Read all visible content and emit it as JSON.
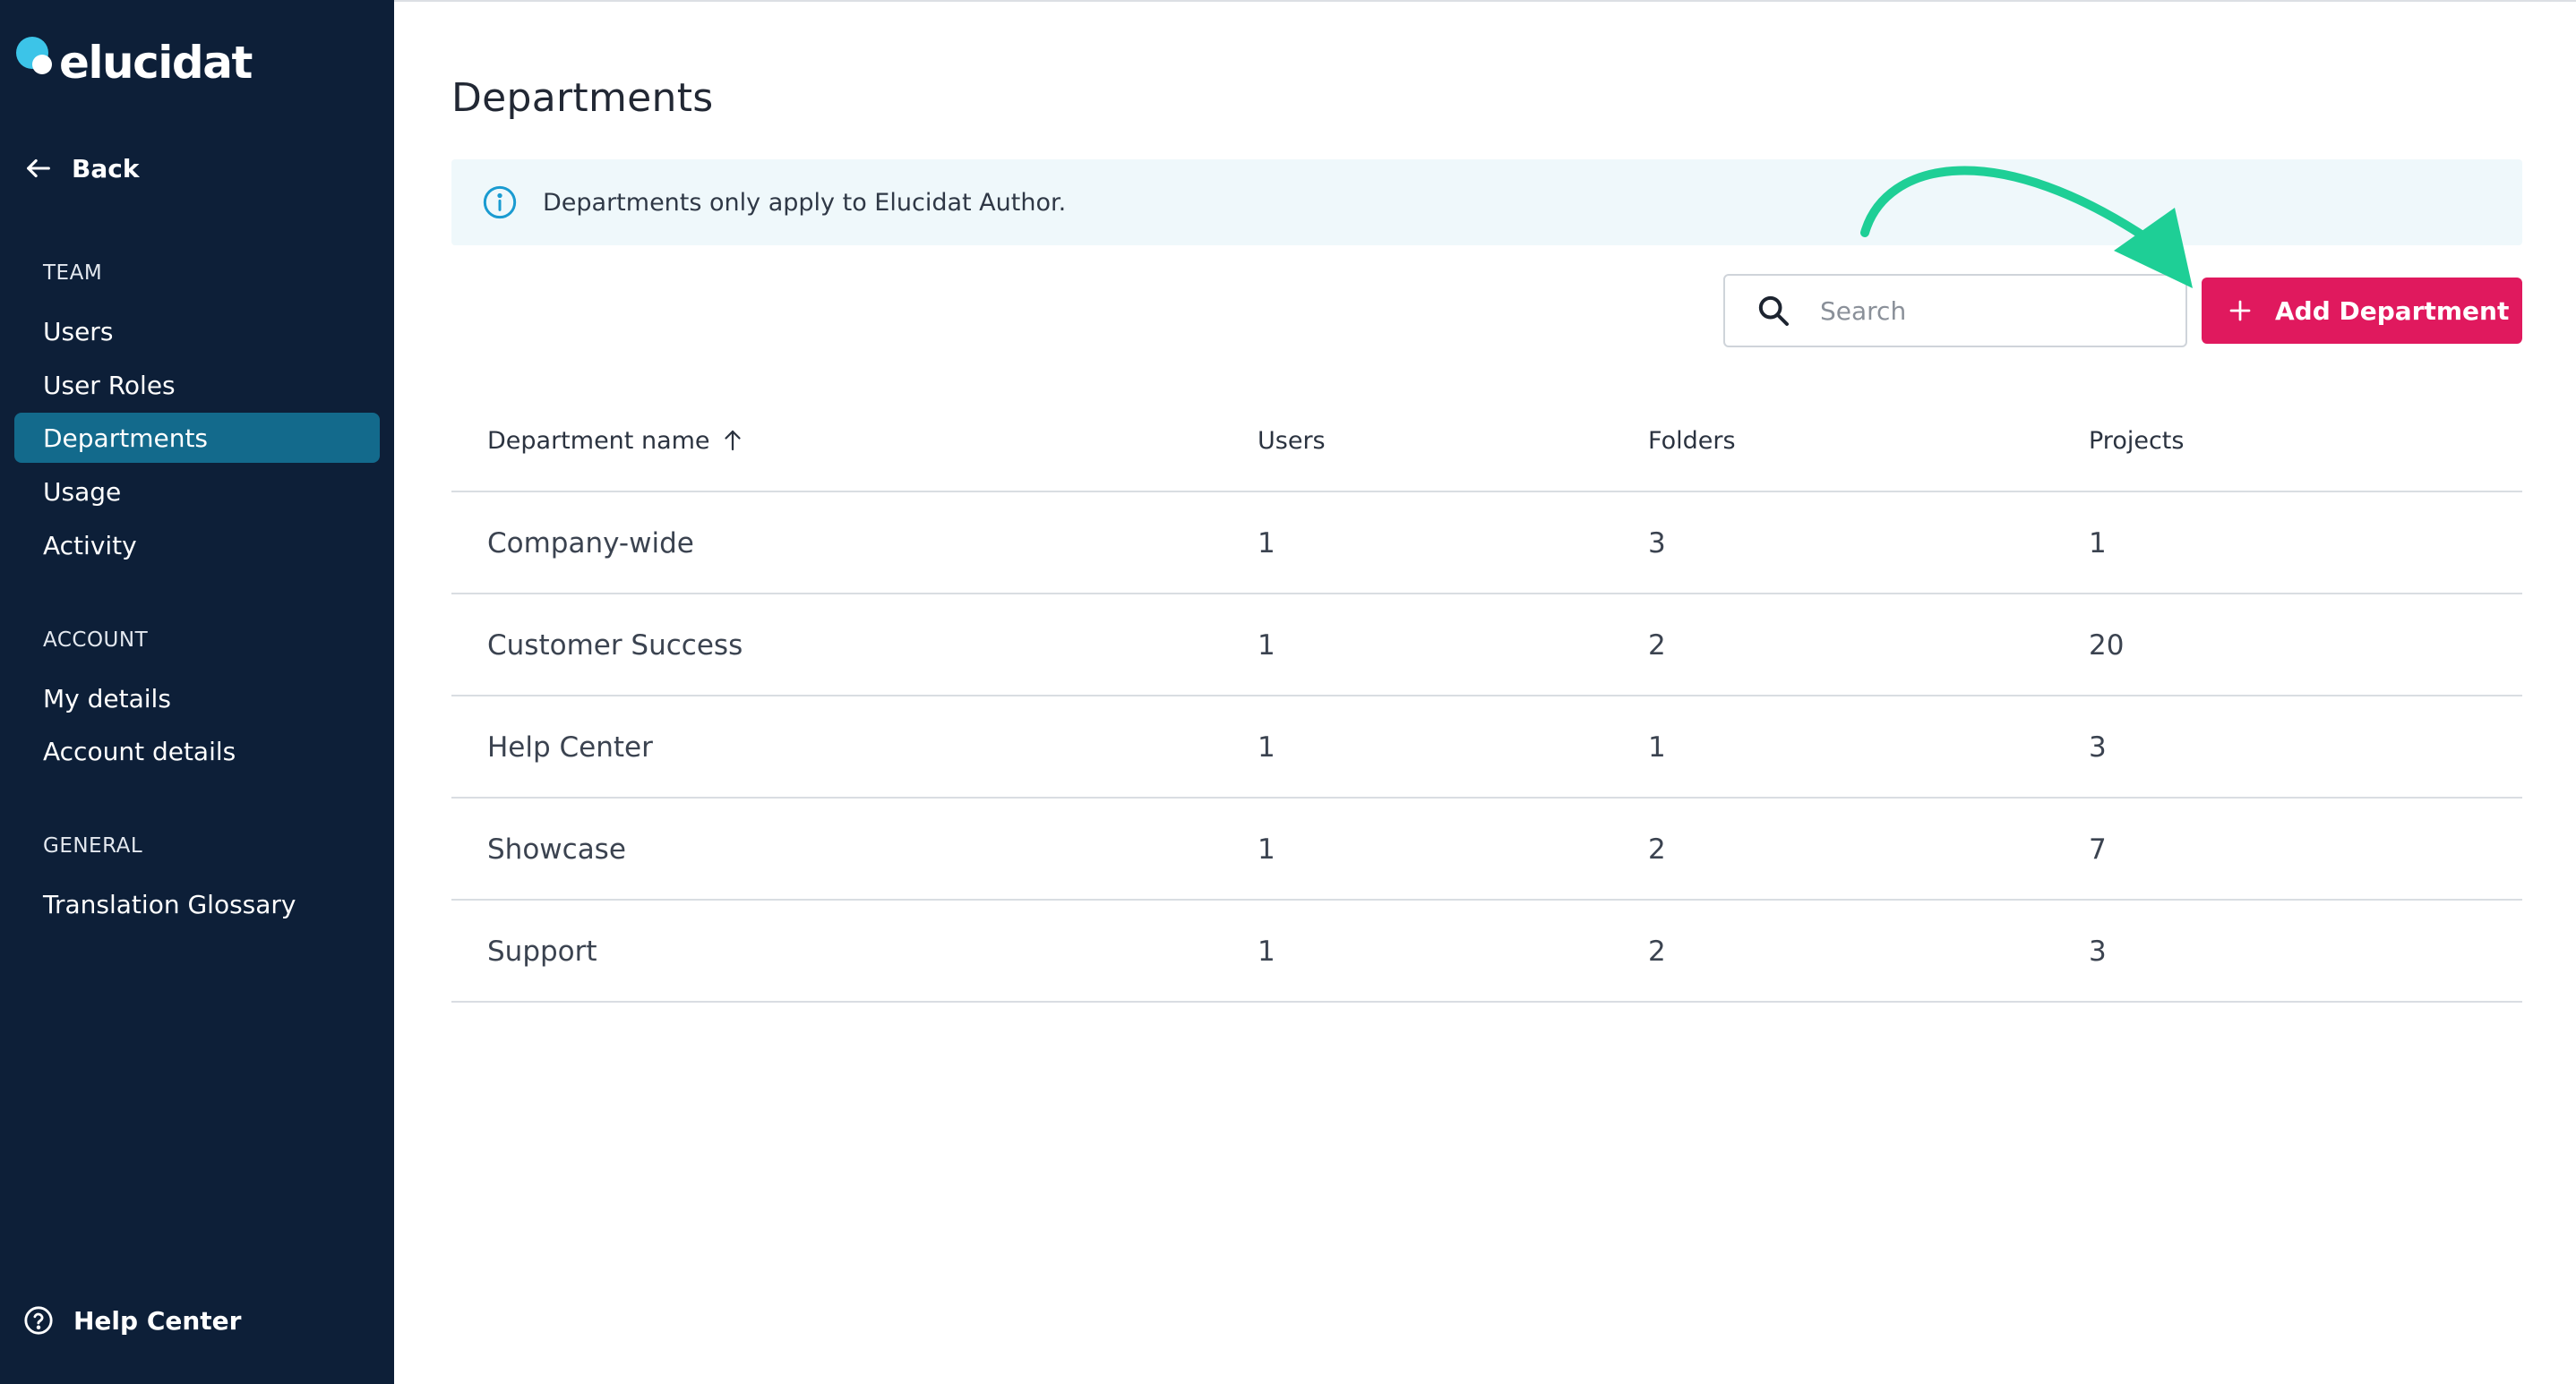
{
  "brand": {
    "name": "elucidat"
  },
  "sidebar": {
    "back_label": "Back",
    "sections": [
      {
        "label": "TEAM",
        "items": [
          {
            "label": "Users"
          },
          {
            "label": "User Roles"
          },
          {
            "label": "Departments",
            "active": true
          },
          {
            "label": "Usage"
          },
          {
            "label": "Activity"
          }
        ]
      },
      {
        "label": "ACCOUNT",
        "items": [
          {
            "label": "My details"
          },
          {
            "label": "Account details"
          }
        ]
      },
      {
        "label": "GENERAL",
        "items": [
          {
            "label": "Translation Glossary"
          }
        ]
      }
    ],
    "help_label": "Help Center"
  },
  "main": {
    "title": "Departments",
    "info_text": "Departments only apply to Elucidat Author.",
    "search": {
      "placeholder": "Search",
      "value": ""
    },
    "add_button_label": "Add Department",
    "table": {
      "columns": [
        "Department name",
        "Users",
        "Folders",
        "Projects"
      ],
      "sort": {
        "column": "Department name",
        "direction": "ascending"
      },
      "rows": [
        {
          "name": "Company-wide",
          "users": "1",
          "folders": "3",
          "projects": "1"
        },
        {
          "name": "Customer Success",
          "users": "1",
          "folders": "2",
          "projects": "20"
        },
        {
          "name": "Help Center",
          "users": "1",
          "folders": "1",
          "projects": "3"
        },
        {
          "name": "Showcase",
          "users": "1",
          "folders": "2",
          "projects": "7"
        },
        {
          "name": "Support",
          "users": "1",
          "folders": "2",
          "projects": "3"
        }
      ]
    }
  },
  "colors": {
    "sidebar_bg": "#0d1f38",
    "active_item": "#136a8c",
    "primary_button": "#e0195e",
    "info_banner_bg": "#eff8fb",
    "annotation_arrow": "#1ecf96"
  },
  "icons": [
    "arrow-left-icon",
    "help-circle-icon",
    "info-icon",
    "search-icon",
    "plus-icon",
    "sort-arrow-up-icon",
    "annotation-arrow-icon"
  ]
}
